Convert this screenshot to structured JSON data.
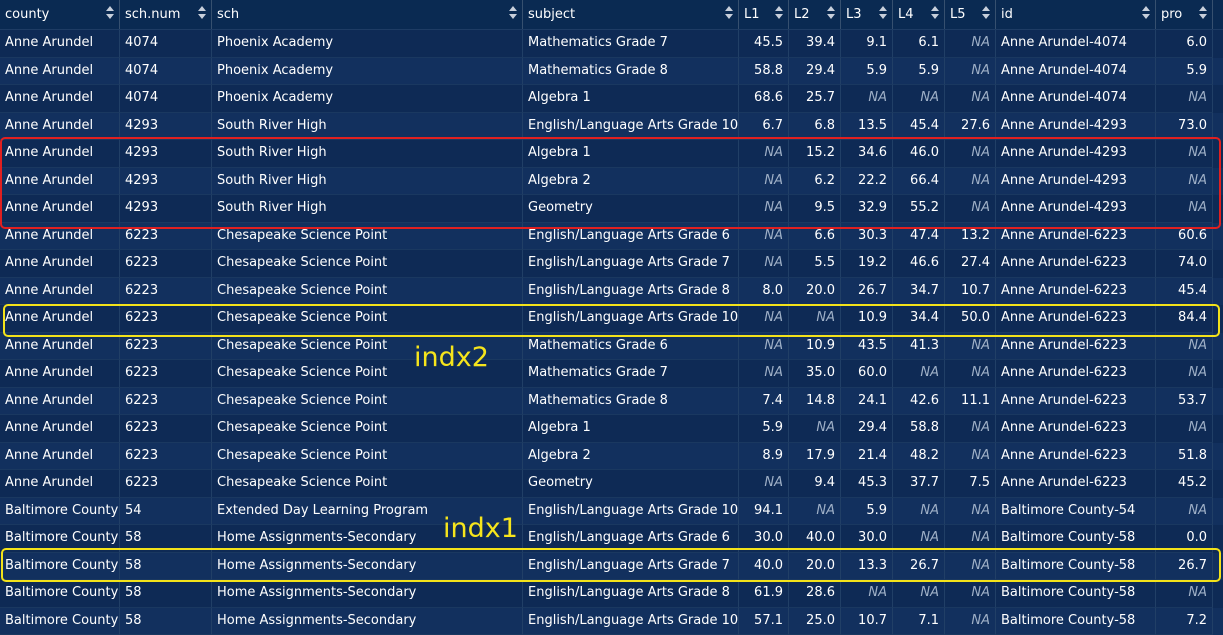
{
  "columns": [
    "county",
    "sch.num",
    "sch",
    "subject",
    "L1",
    "L2",
    "L3",
    "L4",
    "L5",
    "id",
    "pro"
  ],
  "rows": [
    [
      "Anne Arundel",
      "4074",
      "Phoenix Academy",
      "Mathematics Grade 7",
      "45.5",
      "39.4",
      "9.1",
      "6.1",
      "NA",
      "Anne Arundel-4074",
      "6.0"
    ],
    [
      "Anne Arundel",
      "4074",
      "Phoenix Academy",
      "Mathematics Grade 8",
      "58.8",
      "29.4",
      "5.9",
      "5.9",
      "NA",
      "Anne Arundel-4074",
      "5.9"
    ],
    [
      "Anne Arundel",
      "4074",
      "Phoenix Academy",
      "Algebra 1",
      "68.6",
      "25.7",
      "NA",
      "NA",
      "NA",
      "Anne Arundel-4074",
      "NA"
    ],
    [
      "Anne Arundel",
      "4293",
      "South River High",
      "English/Language Arts Grade 10",
      "6.7",
      "6.8",
      "13.5",
      "45.4",
      "27.6",
      "Anne Arundel-4293",
      "73.0"
    ],
    [
      "Anne Arundel",
      "4293",
      "South River High",
      "Algebra 1",
      "NA",
      "15.2",
      "34.6",
      "46.0",
      "NA",
      "Anne Arundel-4293",
      "NA"
    ],
    [
      "Anne Arundel",
      "4293",
      "South River High",
      "Algebra 2",
      "NA",
      "6.2",
      "22.2",
      "66.4",
      "NA",
      "Anne Arundel-4293",
      "NA"
    ],
    [
      "Anne Arundel",
      "4293",
      "South River High",
      "Geometry",
      "NA",
      "9.5",
      "32.9",
      "55.2",
      "NA",
      "Anne Arundel-4293",
      "NA"
    ],
    [
      "Anne Arundel",
      "6223",
      "Chesapeake Science Point",
      "English/Language Arts Grade 6",
      "NA",
      "6.6",
      "30.3",
      "47.4",
      "13.2",
      "Anne Arundel-6223",
      "60.6"
    ],
    [
      "Anne Arundel",
      "6223",
      "Chesapeake Science Point",
      "English/Language Arts Grade 7",
      "NA",
      "5.5",
      "19.2",
      "46.6",
      "27.4",
      "Anne Arundel-6223",
      "74.0"
    ],
    [
      "Anne Arundel",
      "6223",
      "Chesapeake Science Point",
      "English/Language Arts Grade 8",
      "8.0",
      "20.0",
      "26.7",
      "34.7",
      "10.7",
      "Anne Arundel-6223",
      "45.4"
    ],
    [
      "Anne Arundel",
      "6223",
      "Chesapeake Science Point",
      "English/Language Arts Grade 10",
      "NA",
      "NA",
      "10.9",
      "34.4",
      "50.0",
      "Anne Arundel-6223",
      "84.4"
    ],
    [
      "Anne Arundel",
      "6223",
      "Chesapeake Science Point",
      "Mathematics Grade 6",
      "NA",
      "10.9",
      "43.5",
      "41.3",
      "NA",
      "Anne Arundel-6223",
      "NA"
    ],
    [
      "Anne Arundel",
      "6223",
      "Chesapeake Science Point",
      "Mathematics Grade 7",
      "NA",
      "35.0",
      "60.0",
      "NA",
      "NA",
      "Anne Arundel-6223",
      "NA"
    ],
    [
      "Anne Arundel",
      "6223",
      "Chesapeake Science Point",
      "Mathematics Grade 8",
      "7.4",
      "14.8",
      "24.1",
      "42.6",
      "11.1",
      "Anne Arundel-6223",
      "53.7"
    ],
    [
      "Anne Arundel",
      "6223",
      "Chesapeake Science Point",
      "Algebra 1",
      "5.9",
      "NA",
      "29.4",
      "58.8",
      "NA",
      "Anne Arundel-6223",
      "NA"
    ],
    [
      "Anne Arundel",
      "6223",
      "Chesapeake Science Point",
      "Algebra 2",
      "8.9",
      "17.9",
      "21.4",
      "48.2",
      "NA",
      "Anne Arundel-6223",
      "51.8"
    ],
    [
      "Anne Arundel",
      "6223",
      "Chesapeake Science Point",
      "Geometry",
      "NA",
      "9.4",
      "45.3",
      "37.7",
      "7.5",
      "Anne Arundel-6223",
      "45.2"
    ],
    [
      "Baltimore County",
      "54",
      "Extended Day Learning Program",
      "English/Language Arts Grade 10",
      "94.1",
      "NA",
      "5.9",
      "NA",
      "NA",
      "Baltimore County-54",
      "NA"
    ],
    [
      "Baltimore County",
      "58",
      "Home Assignments-Secondary",
      "English/Language Arts Grade 6",
      "30.0",
      "40.0",
      "30.0",
      "NA",
      "NA",
      "Baltimore County-58",
      "0.0"
    ],
    [
      "Baltimore County",
      "58",
      "Home Assignments-Secondary",
      "English/Language Arts Grade 7",
      "40.0",
      "20.0",
      "13.3",
      "26.7",
      "NA",
      "Baltimore County-58",
      "26.7"
    ],
    [
      "Baltimore County",
      "58",
      "Home Assignments-Secondary",
      "English/Language Arts Grade 8",
      "61.9",
      "28.6",
      "NA",
      "NA",
      "NA",
      "Baltimore County-58",
      "NA"
    ],
    [
      "Baltimore County",
      "58",
      "Home Assignments-Secondary",
      "English/Language Arts Grade 10",
      "57.1",
      "25.0",
      "10.7",
      "7.1",
      "NA",
      "Baltimore County-58",
      "7.2"
    ]
  ],
  "annotations": {
    "indx2_label": "indx2",
    "indx1_label": "indx1"
  },
  "colors": {
    "background": "#002451",
    "highlight_red": "#e02020",
    "highlight_yellow": "#f3e21a"
  }
}
